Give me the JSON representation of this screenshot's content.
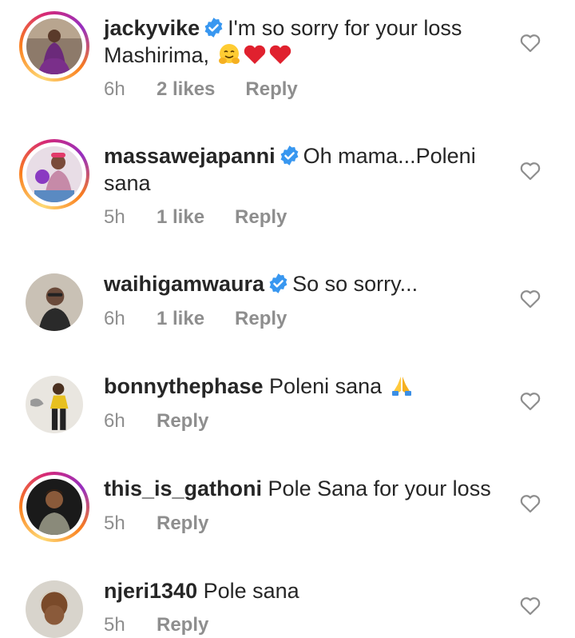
{
  "comments": [
    {
      "username": "jackyvike",
      "verified": true,
      "text": "I'm so sorry for your loss Mashirima,",
      "emojis": [
        "hugging-face",
        "red-heart",
        "red-heart"
      ],
      "time": "6h",
      "likes": "2 likes",
      "reply": "Reply",
      "story_ring": true
    },
    {
      "username": "massawejapanni",
      "verified": true,
      "text": "Oh mama...Poleni sana",
      "time": "5h",
      "likes": "1 like",
      "reply": "Reply",
      "story_ring": true
    },
    {
      "username": "waihigamwaura",
      "verified": true,
      "text": "So so sorry...",
      "time": "6h",
      "likes": "1 like",
      "reply": "Reply",
      "story_ring": false
    },
    {
      "username": "bonnythephase",
      "verified": false,
      "text": "Poleni  sana",
      "emojis": [
        "folded-hands"
      ],
      "time": "6h",
      "reply": "Reply",
      "story_ring": false
    },
    {
      "username": "this_is_gathoni",
      "verified": false,
      "text": "Pole Sana for your loss",
      "time": "5h",
      "reply": "Reply",
      "story_ring": true
    },
    {
      "username": "njeri1340",
      "verified": false,
      "text": "Pole sana",
      "time": "5h",
      "reply": "Reply",
      "story_ring": false
    }
  ],
  "colors": {
    "verified_blue": "#3897f0",
    "meta_gray": "#8e8e8e",
    "text_dark": "#262626"
  }
}
